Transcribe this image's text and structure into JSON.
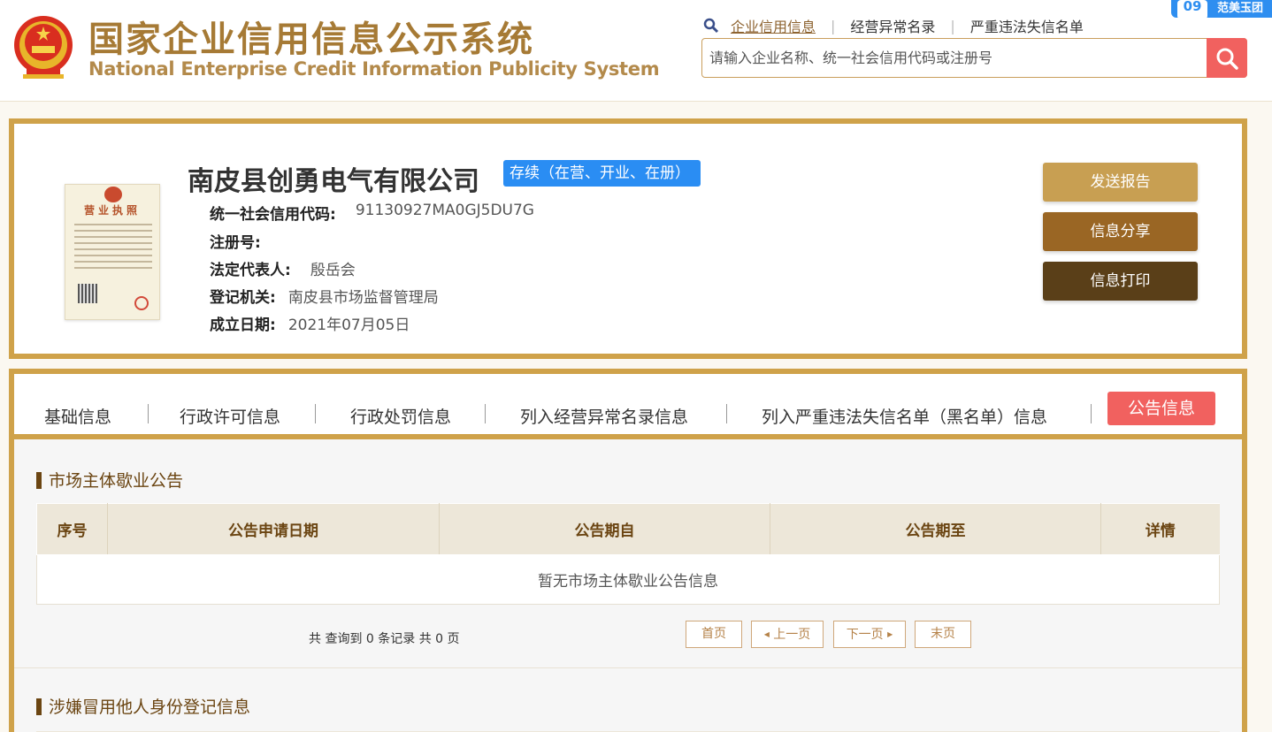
{
  "header": {
    "title_cn": "国家企业信用信息公示系统",
    "title_en": "National Enterprise Credit Information Publicity System",
    "nav": [
      {
        "label": "企业信用信息"
      },
      {
        "label": "经营异常名录"
      },
      {
        "label": "严重违法失信名单"
      }
    ],
    "search_placeholder": "请输入企业名称、统一社会信用代码或注册号",
    "corner_badge_num": "09",
    "corner_badge_text": "范美玉团"
  },
  "company": {
    "name": "南皮县创勇电气有限公司",
    "status": "存续（在营、开业、在册）",
    "license_title": "营业执照",
    "fields": [
      {
        "label": "统一社会信用代码:",
        "value": "91130927MA0GJ5DU7G"
      },
      {
        "label": "注册号:",
        "value": ""
      },
      {
        "label": "法定代表人:",
        "value": "殷岳会"
      },
      {
        "label": "登记机关:",
        "value": "南皮县市场监督管理局"
      },
      {
        "label": "成立日期:",
        "value": "2021年07月05日"
      }
    ],
    "actions": [
      {
        "label": "发送报告"
      },
      {
        "label": "信息分享"
      },
      {
        "label": "信息打印"
      }
    ]
  },
  "tabs": [
    {
      "label": "基础信息"
    },
    {
      "label": "行政许可信息"
    },
    {
      "label": "行政处罚信息"
    },
    {
      "label": "列入经营异常名录信息"
    },
    {
      "label": "列入严重违法失信名单（黑名单）信息"
    },
    {
      "label": "公告信息"
    }
  ],
  "section1": {
    "title": "市场主体歇业公告",
    "columns": [
      "序号",
      "公告申请日期",
      "公告期自",
      "公告期至",
      "详情"
    ],
    "empty_text": "暂无市场主体歇业公告信息",
    "total_text": "共 查询到 0 条记录 共 0 页",
    "pager": {
      "first": "首页",
      "prev": "上一页",
      "next": "下一页",
      "last": "末页"
    }
  },
  "section2": {
    "title": "涉嫌冒用他人身份登记信息"
  },
  "colors": {
    "gold": "#cfa24a",
    "brown": "#6b4512",
    "active_tab": "#f1615f",
    "status_blue": "#2a8df3"
  }
}
